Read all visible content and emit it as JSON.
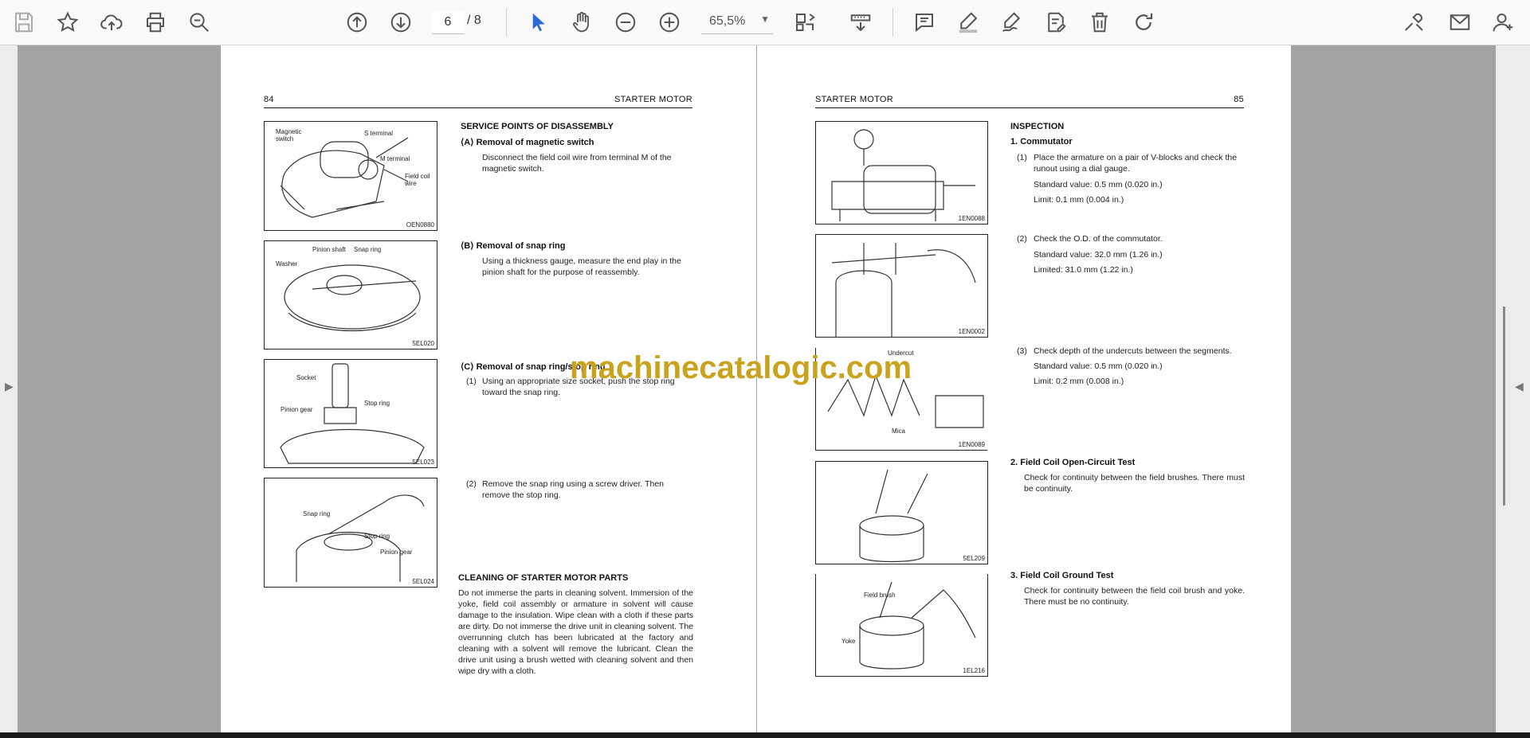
{
  "toolbar": {
    "current_page": "6",
    "page_total": "/ 8",
    "zoom": "65,5%",
    "icons": [
      "save-icon",
      "bookmark-star-icon",
      "upload-icon",
      "print-icon",
      "zoom-search-icon",
      "page-up-icon",
      "page-down-icon",
      "select-cursor-icon",
      "hand-pan-icon",
      "zoom-out-icon",
      "zoom-in-icon",
      "fit-page-icon",
      "stamp-icon",
      "comment-icon",
      "highlight-pen-icon",
      "sign-pen-icon",
      "edit-note-icon",
      "delete-icon",
      "redo-icon",
      "tools-icon",
      "email-icon",
      "add-user-icon"
    ]
  },
  "left_page": {
    "number": "84",
    "title": "STARTER MOTOR",
    "figures": [
      {
        "labels": [
          "Magnetic switch",
          "S terminal",
          "M terminal",
          "Field coil wire"
        ],
        "code": "OEN0880"
      },
      {
        "labels": [
          "Pinion shaft",
          "Snap ring",
          "Washer"
        ],
        "code": "5EL020"
      },
      {
        "labels": [
          "Socket",
          "Stop ring",
          "Pinion gear"
        ],
        "code": "5EL023"
      },
      {
        "labels": [
          "Snap ring",
          "Stop ring",
          "Pinion gear"
        ],
        "code": "5EL024"
      }
    ],
    "section_title": "SERVICE POINTS OF DISASSEMBLY",
    "a_title": "⟨A⟩ Removal of magnetic switch",
    "a_text": "Disconnect the field coil wire from terminal M of the magnetic switch.",
    "b_title": "⟨B⟩ Removal of snap ring",
    "b_text": "Using a thickness gauge, measure the end play in the pinion shaft for the purpose of reassembly.",
    "c_title": "⟨C⟩ Removal of snap ring/stop ring",
    "c1_num": "(1)",
    "c1_text": "Using an appropriate size socket, push the stop ring toward the snap ring.",
    "c2_num": "(2)",
    "c2_text": "Remove the snap ring using a screw driver. Then remove the stop ring.",
    "clean_title": "CLEANING OF STARTER MOTOR PARTS",
    "clean_text": "Do not immerse the parts in cleaning solvent. Immersion of the yoke, field coil assembly or armature in solvent will cause damage to the insulation. Wipe clean with a cloth if these parts are dirty. Do not immerse the drive unit in cleaning solvent. The overrunning clutch has been lubricated at the factory and cleaning with a solvent will remove the lubricant. Clean the drive unit using a brush wetted with cleaning solvent and then wipe dry with a cloth."
  },
  "right_page": {
    "number": "85",
    "title": "STARTER MOTOR",
    "figures": [
      {
        "labels": [],
        "code": "1EN0088"
      },
      {
        "labels": [],
        "code": "1EN0002"
      },
      {
        "labels": [
          "Undercut",
          "Mica"
        ],
        "code": "1EN0089"
      },
      {
        "labels": [],
        "code": "5EL209"
      },
      {
        "labels": [
          "Field brush",
          "Yoke"
        ],
        "code": "1EL216"
      }
    ],
    "inspection_title": "INSPECTION",
    "s1_title": "1. Commutator",
    "s1_1_num": "(1)",
    "s1_1_text": "Place the armature on a pair of V-blocks and check the runout using a dial gauge.",
    "s1_1_std": "Standard value: 0.5 mm (0.020 in.)",
    "s1_1_lim": "Limit: 0.1 mm (0.004 in.)",
    "s1_2_num": "(2)",
    "s1_2_text": "Check the O.D. of the commutator.",
    "s1_2_std": "Standard value: 32.0 mm (1.26 in.)",
    "s1_2_lim": "Limited: 31.0 mm (1.22 in.)",
    "s1_3_num": "(3)",
    "s1_3_text": "Check depth of the undercuts between the segments.",
    "s1_3_std": "Standard value: 0.5 mm (0.020 in.)",
    "s1_3_lim": "Limit: 0.2 mm (0.008 in.)",
    "s2_title": "2. Field Coil Open-Circuit Test",
    "s2_text": "Check for continuity between the field brushes. There must be continuity.",
    "s3_title": "3. Field Coil Ground Test",
    "s3_text": "Check for continuity between the field coil brush and yoke. There must be no continuity."
  },
  "watermark": "machinecatalogic.com",
  "colors": {
    "watermark": "#c9a21e",
    "toolbar_bg": "#f9f9f9",
    "viewer_bg": "#a3a3a3",
    "select_active": "#2b6bd8"
  }
}
